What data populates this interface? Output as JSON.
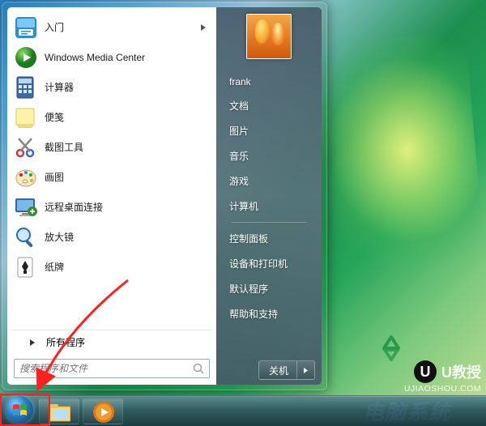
{
  "programs": [
    {
      "id": "getting-started",
      "label": "入门",
      "icon": "#icn-start",
      "expand": true
    },
    {
      "id": "wmc",
      "label": "Windows Media Center",
      "icon": "#icn-wmc",
      "expand": false
    },
    {
      "id": "calculator",
      "label": "计算器",
      "icon": "#icn-calc",
      "expand": false
    },
    {
      "id": "sticky-notes",
      "label": "便笺",
      "icon": "#icn-notes",
      "expand": false
    },
    {
      "id": "snipping-tool",
      "label": "截图工具",
      "icon": "#icn-snip",
      "expand": false
    },
    {
      "id": "paint",
      "label": "画图",
      "icon": "#icn-paint",
      "expand": false
    },
    {
      "id": "remote-desktop",
      "label": "远程桌面连接",
      "icon": "#icn-rdc",
      "expand": false
    },
    {
      "id": "magnifier",
      "label": "放大镜",
      "icon": "#icn-mag",
      "expand": false
    },
    {
      "id": "solitaire",
      "label": "纸牌",
      "icon": "#icn-sol",
      "expand": false
    }
  ],
  "all_programs_label": "所有程序",
  "search": {
    "placeholder": "搜索程序和文件"
  },
  "user_name": "frank",
  "right_links": {
    "group1": [
      "文档",
      "图片",
      "音乐",
      "游戏",
      "计算机"
    ],
    "group2": [
      "控制面板",
      "设备和打印机",
      "默认程序",
      "帮助和支持"
    ]
  },
  "shutdown_label": "关机",
  "watermark": {
    "brand": "U教授",
    "url": "UJIAOSHOU.COM",
    "overlay": "电脑系统"
  }
}
